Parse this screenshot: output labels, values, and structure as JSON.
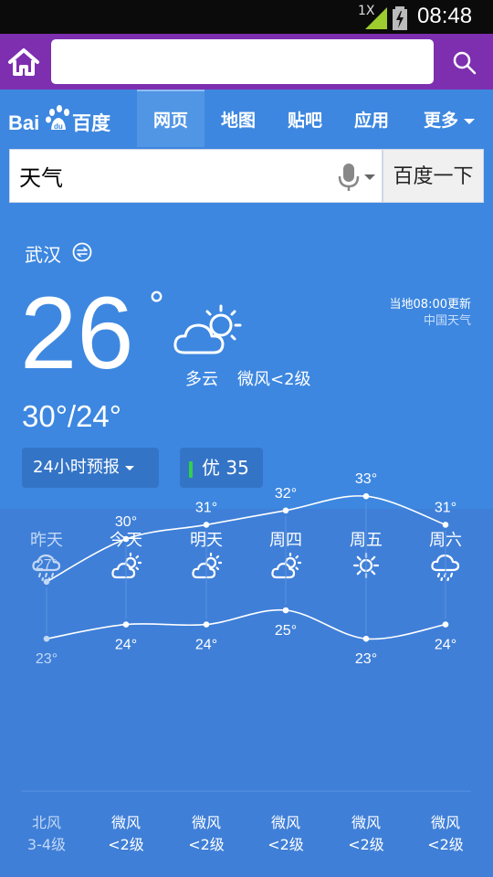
{
  "status_bar": {
    "network": "1X",
    "time": "08:48"
  },
  "browser": {
    "url_value": ""
  },
  "nav": {
    "logo": "Bai百度",
    "tabs": [
      "网页",
      "地图",
      "贴吧",
      "应用",
      "更多"
    ]
  },
  "search": {
    "query": "天气",
    "button": "百度一下"
  },
  "current": {
    "city": "武汉",
    "temp": "26",
    "deg": "°",
    "condition": "多云",
    "wind": "微风<2级",
    "update": "当地08:00更新",
    "source": "中国天气",
    "range": "30°/24°",
    "forecast_button": "24小时预报",
    "aqi": "优 35",
    "aqi_color": "#31d04a"
  },
  "forecast": {
    "days": [
      {
        "label": "昨天",
        "icon": "rain-cloud-icon",
        "high": "27°",
        "low": "23°",
        "wind": "北风",
        "level": "3-4级",
        "past": true
      },
      {
        "label": "今天",
        "icon": "partly-cloudy-icon",
        "high": "30°",
        "low": "24°",
        "wind": "微风",
        "level": "<2级",
        "past": false
      },
      {
        "label": "明天",
        "icon": "partly-cloudy-icon",
        "high": "31°",
        "low": "24°",
        "wind": "微风",
        "level": "<2级",
        "past": false
      },
      {
        "label": "周四",
        "icon": "partly-cloudy-icon",
        "high": "32°",
        "low": "25°",
        "wind": "微风",
        "level": "<2级",
        "past": false
      },
      {
        "label": "周五",
        "icon": "sun-icon",
        "high": "33°",
        "low": "23°",
        "wind": "微风",
        "level": "<2级",
        "past": false
      },
      {
        "label": "周六",
        "icon": "rain-cloud-icon",
        "high": "31°",
        "low": "24°",
        "wind": "微风",
        "level": "<2级",
        "past": false
      }
    ]
  },
  "chart_data": {
    "type": "line",
    "categories": [
      "昨天",
      "今天",
      "明天",
      "周四",
      "周五",
      "周六"
    ],
    "series": [
      {
        "values": [
          27,
          30,
          31,
          32,
          33,
          31
        ]
      },
      {
        "values": [
          23,
          24,
          24,
          25,
          23,
          24
        ]
      }
    ]
  }
}
